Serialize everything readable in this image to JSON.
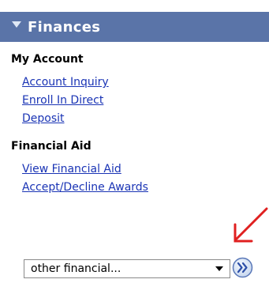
{
  "panel": {
    "title": "Finances"
  },
  "my_account": {
    "heading": "My Account",
    "links": [
      "Account Inquiry",
      "Enroll In Direct",
      "Deposit"
    ]
  },
  "financial_aid": {
    "heading": "Financial Aid",
    "links": [
      "View Financial Aid",
      "Accept/Decline Awards"
    ]
  },
  "dropdown": {
    "selected": "other financial..."
  },
  "colors": {
    "header_bg": "#5a74a8",
    "link": "#1a34b5",
    "annotation_arrow": "#e02020"
  },
  "icons": {
    "header_toggle": "triangle-down-icon",
    "dropdown_caret": "chevron-down-icon",
    "go_button": "double-chevron-right-icon",
    "annotation": "red-arrow-icon"
  }
}
